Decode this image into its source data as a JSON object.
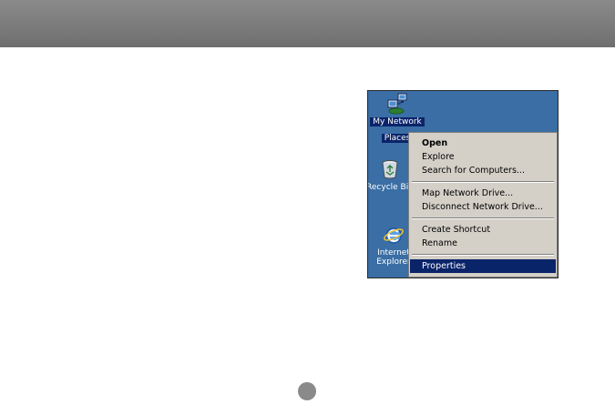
{
  "desktop": {
    "icons": [
      {
        "name": "network-places-icon",
        "label_lines": [
          "My Network",
          "Places"
        ],
        "selected": true
      },
      {
        "name": "recycle-bin-icon",
        "label_lines": [
          "Recycle Bin"
        ],
        "selected": false
      },
      {
        "name": "internet-explorer-icon",
        "label_lines": [
          "Internet",
          "Explorer"
        ],
        "selected": false
      }
    ]
  },
  "context_menu": {
    "items": [
      {
        "label": "Open",
        "bold": true
      },
      {
        "label": "Explore"
      },
      {
        "label": "Search for Computers..."
      },
      {
        "separator": true
      },
      {
        "label": "Map Network Drive..."
      },
      {
        "label": "Disconnect Network Drive..."
      },
      {
        "separator": true
      },
      {
        "label": "Create Shortcut"
      },
      {
        "label": "Rename"
      },
      {
        "separator": true
      },
      {
        "label": "Properties",
        "highlighted": true
      }
    ]
  },
  "colors": {
    "desktop_background": "#3a6ea5",
    "menu_background": "#d4d0c8",
    "selection": "#0a246a",
    "header_bar": "#7a7a7a"
  }
}
